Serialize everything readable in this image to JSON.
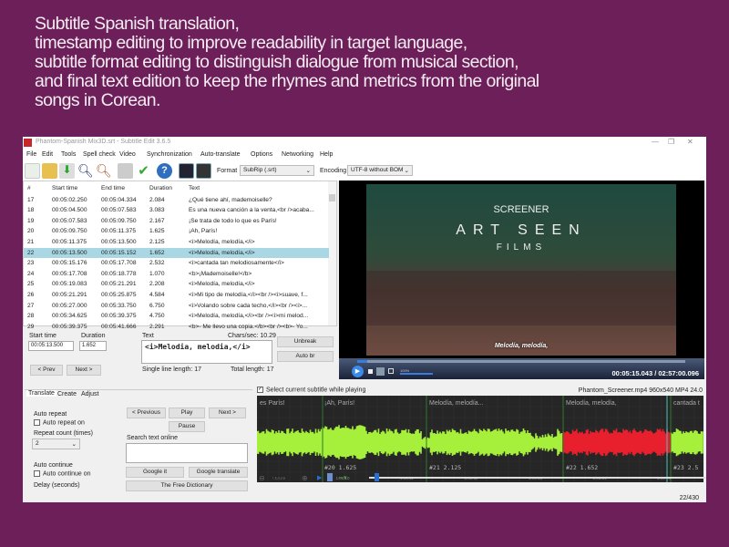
{
  "caption": [
    "Subtitle Spanish translation,",
    "timestamp editing to improve readability in target language,",
    "subtitle format editing to distinguish dialogue from musical section,",
    "and final text edition to keep the rhymes and metrics from the original",
    "songs in Corean."
  ],
  "window": {
    "title": "Phantom-Spanish Mix3D.srt - Subtitle Edit 3.6.5"
  },
  "menu": [
    "File",
    "Edit",
    "Tools",
    "Spell check",
    "Video",
    "Synchronization",
    "Auto-translate",
    "Options",
    "Networking",
    "Help"
  ],
  "toolbar": {
    "icons": [
      "new-file-icon",
      "open-folder-icon",
      "download-icon",
      "find-icon",
      "replace-icon",
      "sync-icon",
      "spell-check-icon",
      "help-icon",
      "waveform-icon",
      "video-icon"
    ],
    "format_label": "Format",
    "format_value": "SubRip (.srt)",
    "encoding_label": "Encoding",
    "encoding_value": "UTF-8 without BOM"
  },
  "grid": {
    "headers": [
      "#",
      "Start time",
      "End time",
      "Duration",
      "Text"
    ],
    "rows": [
      [
        "17",
        "00:05:02.250",
        "00:05:04.334",
        "2.084",
        "¿Qué tiene ahí, mademoiselle?"
      ],
      [
        "18",
        "00:05:04.500",
        "00:05:07.583",
        "3.083",
        "Es una nueva canción a la venta,<br />acaba..."
      ],
      [
        "19",
        "00:05:07.583",
        "00:05:09.750",
        "2.167",
        "¡Se trata de todo lo que es París!"
      ],
      [
        "20",
        "00:05:09.750",
        "00:05:11.375",
        "1.625",
        "¡Ah, París!"
      ],
      [
        "21",
        "00:05:11.375",
        "00:05:13.500",
        "2.125",
        "<i>Melodía, melodía,</i>"
      ],
      [
        "22",
        "00:05:13.500",
        "00:05:15.152",
        "1.652",
        "<i>Melodía, melodía,</i>"
      ],
      [
        "23",
        "00:05:15.176",
        "00:05:17.708",
        "2.532",
        "<i>cantada tan melodiosamente</i>"
      ],
      [
        "24",
        "00:05:17.708",
        "00:05:18.778",
        "1.070",
        "<b>¡Mademoiselle!</b>"
      ],
      [
        "25",
        "00:05:19.083",
        "00:05:21.291",
        "2.208",
        "<i>Melodía, melodía,</i>"
      ],
      [
        "26",
        "00:05:21.291",
        "00:05:25.875",
        "4.584",
        "<i>Mi tipo de melodía,</i><br /><i>suave, f..."
      ],
      [
        "27",
        "00:05:27.000",
        "00:05:33.750",
        "6.750",
        "<i>Volando sobre cada techo,</i><br /><i>..."
      ],
      [
        "28",
        "00:05:34.625",
        "00:05:39.375",
        "4.750",
        "<i>Melodía, melodía,</i><br /><i>mi melod..."
      ],
      [
        "29",
        "00:05:39.375",
        "00:05:41.666",
        "2.291",
        "<b>- Me llevo una copia.</b><br /><b>- Yo..."
      ]
    ],
    "selected_index": 5
  },
  "video": {
    "overlay_top": "SCREENER",
    "overlay_mid": "ART SEEN",
    "overlay_bot": "FILMS",
    "subtitle": "Melodía, melodía,",
    "volume": "100%",
    "time": "00:05:15.043 / 02:57:00.096",
    "progress": 0.03
  },
  "edit": {
    "start_label": "Start time",
    "start_value": "00:05:13.500",
    "duration_label": "Duration",
    "duration_value": "1.652",
    "text_label": "Text",
    "chars_sec": "Chars/sec: 10.29",
    "text_value": "<i>Melodia, melodia,</i>",
    "single_line": "Single line length: 17",
    "total_length": "Total length: 17",
    "unbreak": "Unbreak",
    "auto_br": "Auto br",
    "prev": "< Prev",
    "next": "Next >"
  },
  "tabs": [
    "Translate",
    "Create",
    "Adjust"
  ],
  "translate": {
    "auto_repeat": "Auto repeat",
    "auto_repeat_on": "Auto repeat on",
    "repeat_count": "Repeat count (times)",
    "repeat_value": "2",
    "auto_continue": "Auto continue",
    "auto_continue_on": "Auto continue on",
    "delay": "Delay (seconds)",
    "previous": "< Previous",
    "play": "Play",
    "next": "Next >",
    "pause": "Pause",
    "search_label": "Search text online",
    "google_it": "Google it",
    "google_translate": "Google translate",
    "free_dictionary": "The Free Dictionary"
  },
  "waveform": {
    "select_current": "Select current subtitle while playing",
    "video_info": "Phantom_Screener.mp4 960x540 MP4 24.0",
    "labels": [
      "es París!",
      "¡Ah, París!",
      "Melodía, melodía...",
      "Melodía, melodía,",
      "cantada t"
    ],
    "numbers": [
      "#20  1.625",
      "#21  2.125",
      "#22  1.652",
      "#23  2.5"
    ],
    "ticks": [
      "1:05:09",
      "1:05:10",
      "1:05:11",
      "1:05:12",
      "1:05:13",
      "1:05:14",
      "1:05:15"
    ],
    "zoom": "100%",
    "colors": {
      "wave": "#a6f03c",
      "selected": "#e8202e",
      "background": "#262626"
    }
  },
  "status": {
    "count": "22/430"
  }
}
